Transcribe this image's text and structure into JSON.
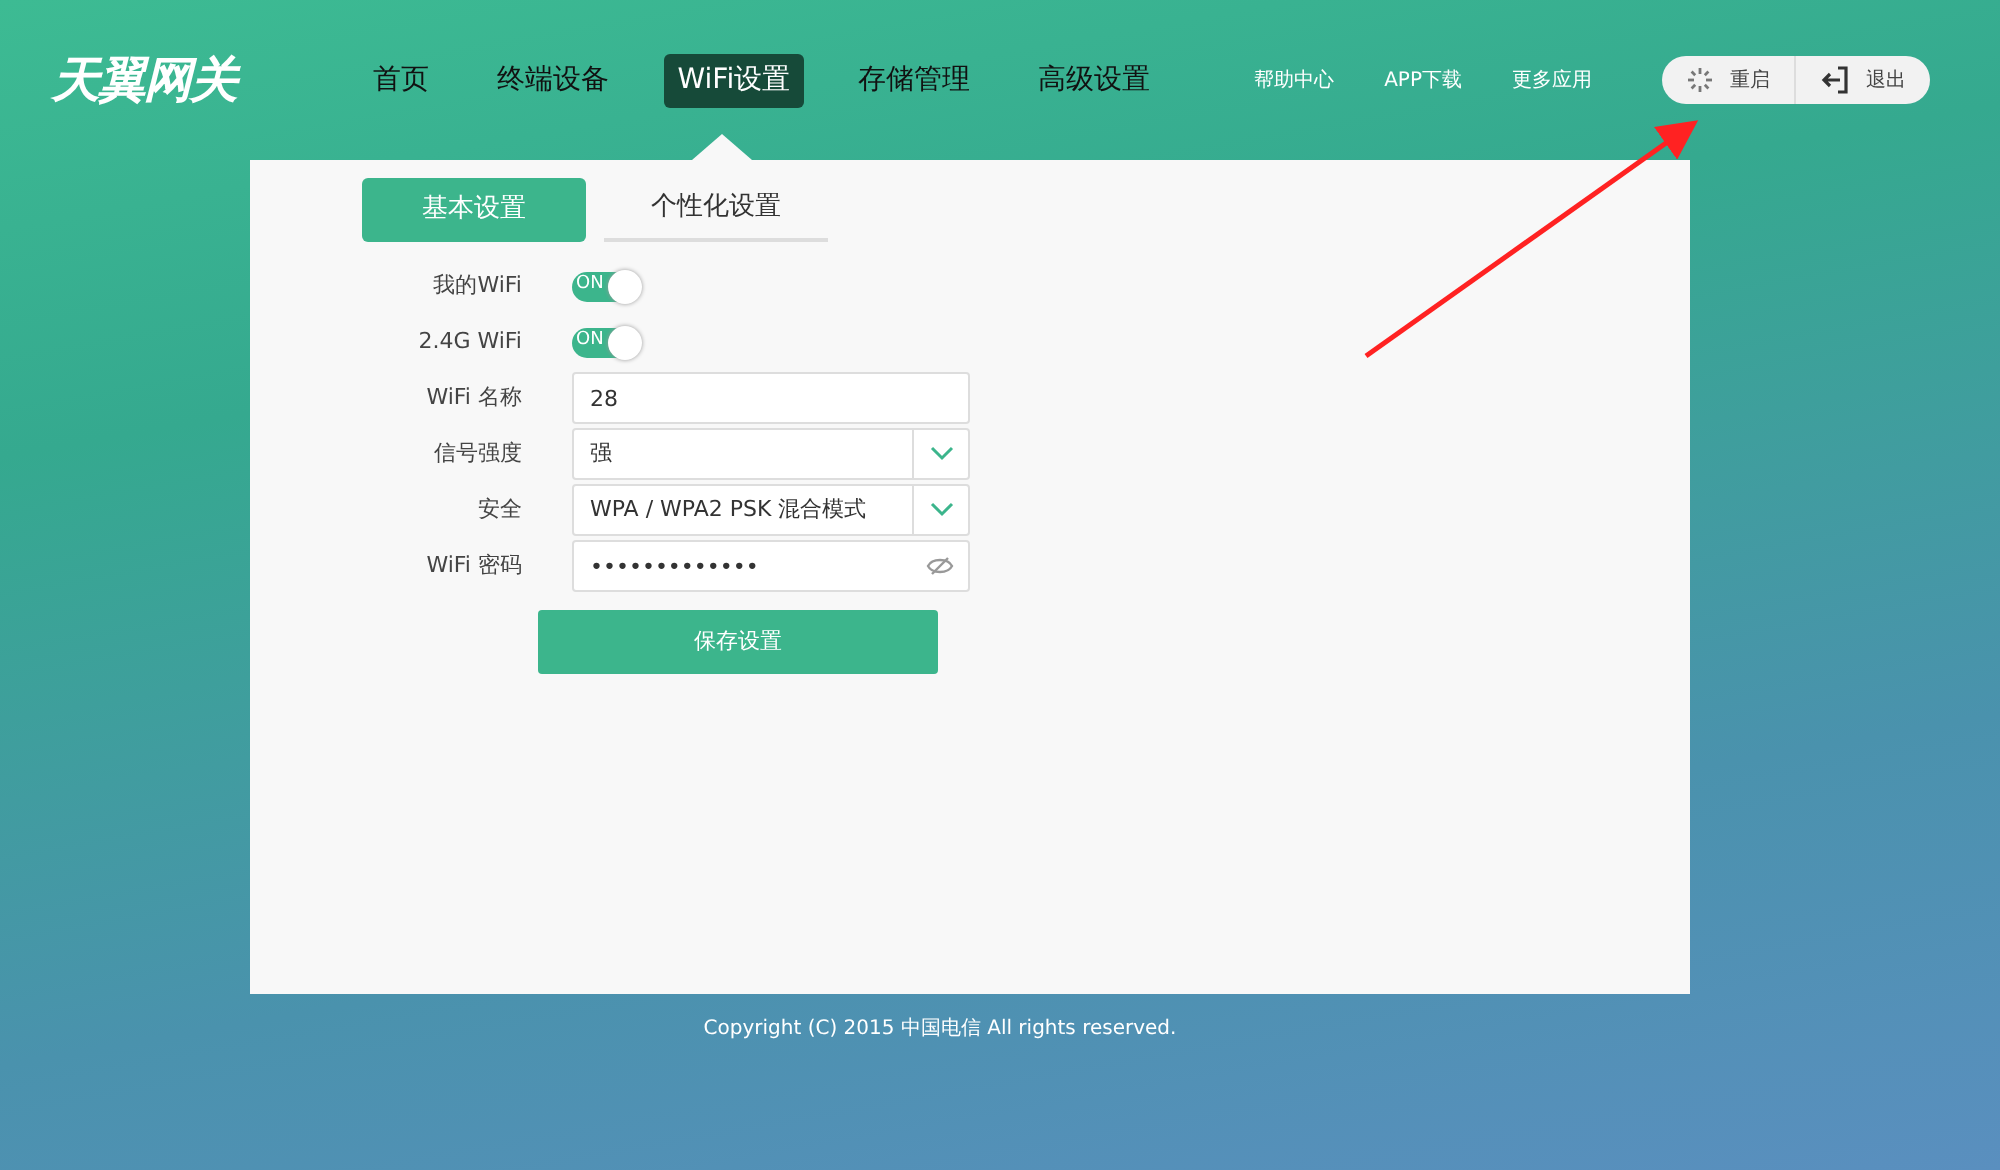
{
  "header": {
    "logo": "天翼网关",
    "nav": [
      {
        "label": "首页",
        "selected": false
      },
      {
        "label": "终端设备",
        "selected": false
      },
      {
        "label": "WiFi设置",
        "selected": true
      },
      {
        "label": "存储管理",
        "selected": false
      },
      {
        "label": "高级设置",
        "selected": false
      }
    ],
    "links": [
      "帮助中心",
      "APP下载",
      "更多应用"
    ],
    "actions": [
      {
        "label": "重启",
        "kind": "restart"
      },
      {
        "label": "退出",
        "kind": "logout"
      }
    ]
  },
  "tabs": [
    {
      "label": "基本设置",
      "selected": true
    },
    {
      "label": "个性化设置",
      "selected": false
    }
  ],
  "form": {
    "rows": [
      {
        "label": "我的WiFi",
        "kind": "toggle",
        "on": true,
        "text": "ON"
      },
      {
        "label": "2.4G WiFi",
        "kind": "toggle",
        "on": true,
        "text": "ON"
      },
      {
        "label": "WiFi 名称",
        "kind": "text",
        "value": "28"
      },
      {
        "label": "信号强度",
        "kind": "select",
        "value": "强"
      },
      {
        "label": "安全",
        "kind": "select",
        "value": "WPA / WPA2 PSK 混合模式"
      },
      {
        "label": "WiFi 密码",
        "kind": "password",
        "value": "•••••••••••••"
      }
    ],
    "save_button": "保存设置"
  },
  "footer": "Copyright (C) 2015 中国电信 All rights reserved."
}
